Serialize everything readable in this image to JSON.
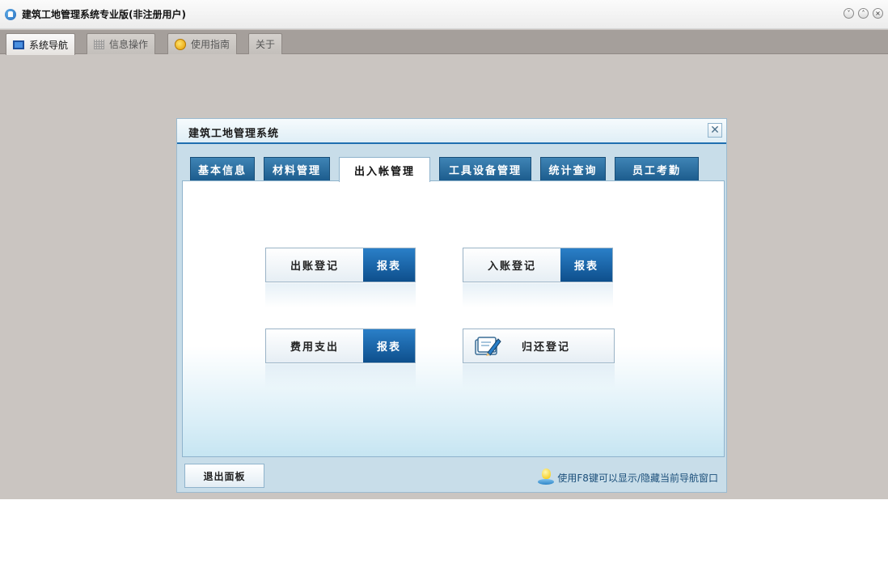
{
  "window": {
    "title": "建筑工地管理系统专业版(非注册用户)",
    "controls": [
      "minimize",
      "restore",
      "close"
    ]
  },
  "top_tabs": [
    {
      "label": "系统导航",
      "icon": "monitor-icon",
      "active": true
    },
    {
      "label": "信息操作",
      "icon": "grid-icon",
      "active": false
    },
    {
      "label": "使用指南",
      "icon": "help-icon",
      "active": false
    },
    {
      "label": "关于",
      "icon": "",
      "active": false
    }
  ],
  "panel": {
    "title": "建筑工地管理系统",
    "tabs": [
      {
        "label": "基本信息",
        "active": false
      },
      {
        "label": "材料管理",
        "active": false
      },
      {
        "label": "出入帐管理",
        "active": true
      },
      {
        "label": "工具设备管理",
        "active": false
      },
      {
        "label": "统计查询",
        "active": false
      },
      {
        "label": "员工考勤",
        "active": false
      }
    ],
    "actions": {
      "outgoing": {
        "label": "出账登记",
        "report": "报表"
      },
      "incoming": {
        "label": "入账登记",
        "report": "报表"
      },
      "expense": {
        "label": "费用支出",
        "report": "报表"
      },
      "return": {
        "label": "归还登记",
        "icon": "notebook-icon"
      }
    },
    "exit_label": "退出面板",
    "hint_text": "使用F8键可以显示/隐藏当前导航窗口"
  },
  "colors": {
    "accent_blue": "#1f6fb0",
    "tab_blue": "#2b6f9f",
    "workspace_gray": "#cac5c1"
  }
}
